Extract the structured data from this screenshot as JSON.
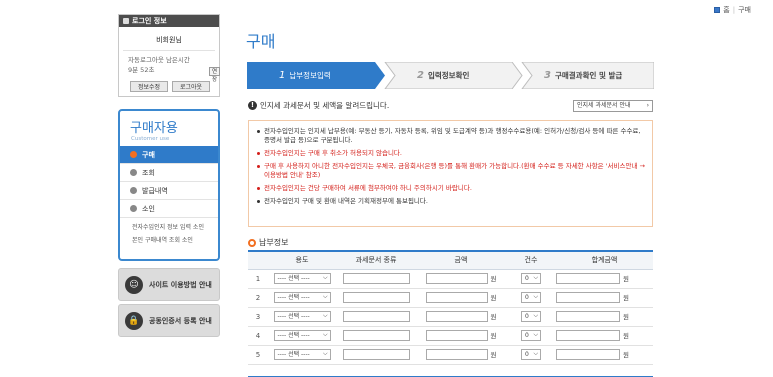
{
  "top_links": {
    "home": "홈",
    "sitemap": "구매"
  },
  "login": {
    "header": "로그인 정보",
    "user": "비회원님",
    "timer_label": "자동로그아웃 남은시간",
    "timer_value": "9분 52초",
    "extend_label": "연장",
    "info_edit_label": "정보수정",
    "logout_label": "로그아웃"
  },
  "menu": {
    "title": "구매자용",
    "subtitle": "Customer use",
    "items": [
      {
        "label": "구매",
        "active": true
      },
      {
        "label": "조회",
        "active": false
      },
      {
        "label": "발급내역",
        "active": false
      },
      {
        "label": "소인",
        "active": false
      }
    ],
    "sub_links": [
      "전자수입인지 정보 입력 소인",
      "본인 구매내역 조회 소인"
    ]
  },
  "banners": {
    "guide": "사이트 이용방법 안내",
    "cert": "공동인증서 등록 안내"
  },
  "page_title": "구매",
  "steps": [
    {
      "num": "1",
      "label": "납부정보입력",
      "active": true
    },
    {
      "num": "2",
      "label": "입력정보확인",
      "active": false
    },
    {
      "num": "3",
      "label": "구매결과확인 및 발급",
      "active": false
    }
  ],
  "notice": {
    "text": "인지세 과세문서 및 세액을 알려드립니다.",
    "button": "인지세 과세문서 안내"
  },
  "info_items": [
    {
      "text": "전자수입인지는 인지세 납부용(예: 부동산 등기, 자동차 등록, 위임 및 도급계약 등)과 행정수수료용(예: 인허가/신청/검사 등에 따른 수수료, 증명서 발급 등)으로 구분됩니다.",
      "red": false
    },
    {
      "text": "전자수입인지는 구매 후 취소가 허용되지 않습니다.",
      "red": true
    },
    {
      "text": "구매 후 사용하지 아니한 전자수입인지는 우체국, 금융회사(은행 등)를 통해 환매가 가능합니다.(환매 수수료 등 자세한 사항은 '서비스안내 → 이용방법 안내' 참조)",
      "red": true
    },
    {
      "text": "전자수입인지는 건당 구매하여 서류에 첨부하여야 하니 주의하시기 바랍니다.",
      "red": true
    },
    {
      "text": "전자수입인지 구매 및 환매 내역은 기획재정부에 통보됩니다.",
      "red": false
    }
  ],
  "payment": {
    "section_title": "납부정보",
    "headers": [
      "",
      "용도",
      "과세문서 종류",
      "금액",
      "건수",
      "합계금액"
    ],
    "rows": [
      {
        "no": "1",
        "purpose": "---- 선택 ----",
        "unit": "원",
        "count": "0",
        "unit2": "원"
      },
      {
        "no": "2",
        "purpose": "---- 선택 ----",
        "unit": "원",
        "count": "0",
        "unit2": "원"
      },
      {
        "no": "3",
        "purpose": "---- 선택 ----",
        "unit": "원",
        "count": "0",
        "unit2": "원"
      },
      {
        "no": "4",
        "purpose": "---- 선택 ----",
        "unit": "원",
        "count": "0",
        "unit2": "원"
      },
      {
        "no": "5",
        "purpose": "---- 선택 ----",
        "unit": "원",
        "count": "0",
        "unit2": "원"
      }
    ]
  },
  "colors": {
    "accent": "#2f7bc9",
    "warning": "#d4201b",
    "orange": "#f26f21"
  }
}
